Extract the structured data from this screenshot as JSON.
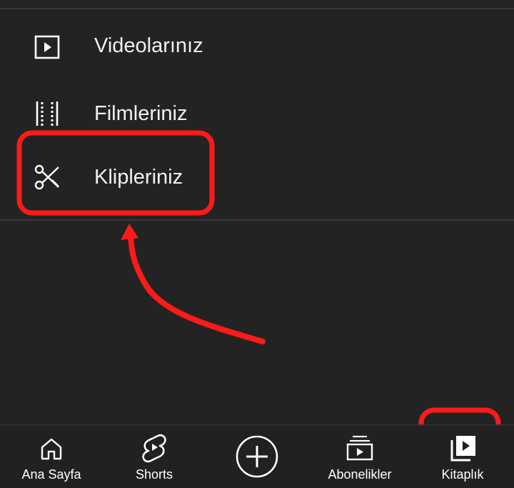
{
  "menu": {
    "items": [
      {
        "icon": "play-square-icon",
        "label": "Videolarınız"
      },
      {
        "icon": "film-strip-icon",
        "label": "Filmleriniz"
      },
      {
        "icon": "scissors-icon",
        "label": "Klipleriniz"
      }
    ]
  },
  "bottom_nav": {
    "items": [
      {
        "icon": "home-icon",
        "label": "Ana Sayfa"
      },
      {
        "icon": "shorts-icon",
        "label": "Shorts"
      },
      {
        "icon": "create-plus-icon",
        "label": ""
      },
      {
        "icon": "subscriptions-icon",
        "label": "Abonelikler"
      },
      {
        "icon": "library-icon",
        "label": "Kitaplık"
      }
    ]
  },
  "colors": {
    "background": "#232323",
    "text": "#ffffff",
    "annotation": "#ff1a1a"
  }
}
